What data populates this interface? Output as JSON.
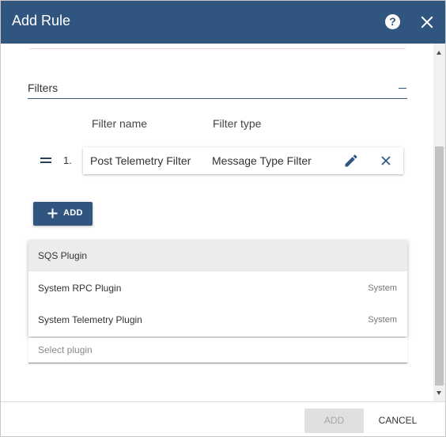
{
  "dialog": {
    "title": "Add Rule",
    "help_icon": "help-circle-icon",
    "help_glyph": "?",
    "close_icon": "close-icon"
  },
  "filters": {
    "label": "Filters",
    "collapse_icon": "minus-icon",
    "columns": {
      "name": "Filter name",
      "type": "Filter type"
    },
    "items": [
      {
        "index": "1.",
        "name": "Post Telemetry Filter",
        "type": "Message Type Filter"
      }
    ],
    "add_label": "ADD"
  },
  "plugin": {
    "options": [
      {
        "name": "SQS Plugin",
        "tag": "",
        "highlighted": true
      },
      {
        "name": "System RPC Plugin",
        "tag": "System",
        "highlighted": false
      },
      {
        "name": "System Telemetry Plugin",
        "tag": "System",
        "highlighted": false
      }
    ],
    "placeholder": "Select plugin"
  },
  "footer": {
    "add_label": "ADD",
    "add_disabled": true,
    "cancel_label": "CANCEL"
  },
  "colors": {
    "primary": "#305680",
    "highlight": "#ececec",
    "disabled_bg": "#e0e0e0",
    "disabled_text": "#a6a6a6"
  }
}
